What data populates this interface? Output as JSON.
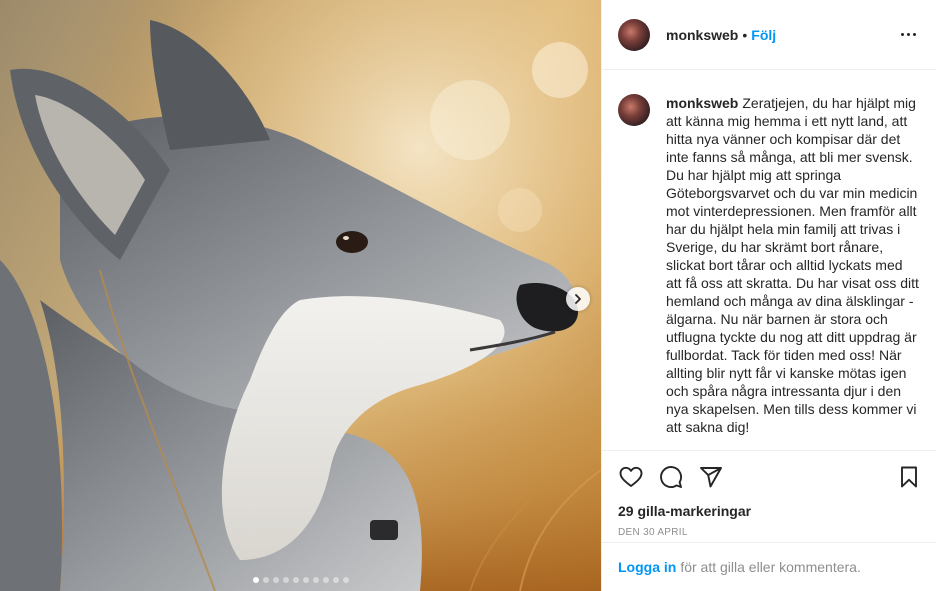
{
  "post": {
    "username": "monksweb",
    "separator": "•",
    "follow_label": "Följ",
    "more_icon": "more-options-icon",
    "caption": "Zeratjejen, du har hjälpt mig att känna mig hemma i ett nytt land, att hitta nya vänner och kompisar där det inte fanns så många, att bli mer svensk. Du har hjälpt mig att springa Göteborgsvarvet och du var min medicin mot vinterdepressionen. Men framför allt har du hjälpt hela min familj att trivas i Sverige, du har skrämt bort rånare, slickat bort tårar och alltid lyckats med att få oss att skratta. Du har visat oss ditt hemland och många av dina älsklingar - älgarna. Nu när barnen är stora och utflugna tyckte du nog att ditt uppdrag är fullbordat. Tack för tiden med oss! När allting blir nytt får vi kanske mötas igen och spåra några intressanta djur i den nya skapelsen. Men tills dess kommer vi att sakna dig!",
    "likes": "29 gilla-markeringar",
    "date": "DEN 30 APRIL"
  },
  "carousel": {
    "total_slides": 10,
    "active_slide": 1,
    "next_icon": "chevron-right-icon"
  },
  "actions": {
    "like_icon": "heart-icon",
    "comment_icon": "comment-icon",
    "share_icon": "share-icon",
    "save_icon": "bookmark-icon"
  },
  "footer": {
    "login_label": "Logga in",
    "login_suffix": "för att gilla eller kommentera."
  },
  "colors": {
    "link_blue": "#0095f6",
    "text": "#262626",
    "muted": "#8e8e8e",
    "divider": "#efefef"
  }
}
